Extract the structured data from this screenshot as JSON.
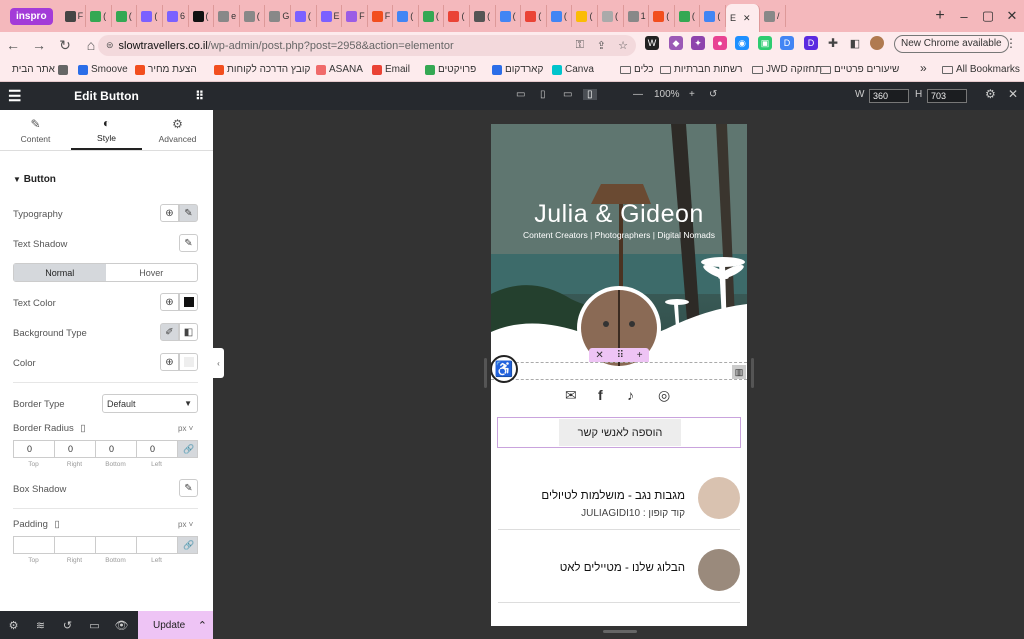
{
  "browser": {
    "profile_label": "inspro",
    "tabs": [
      {
        "label": "F",
        "color": "#444"
      },
      {
        "label": "(",
        "color": "#34a853"
      },
      {
        "label": "(",
        "color": "#34a853"
      },
      {
        "label": "(",
        "color": "#7b61ff"
      },
      {
        "label": "6",
        "color": "#7b61ff"
      },
      {
        "label": "(",
        "color": "#111"
      },
      {
        "label": "e",
        "color": "#888"
      },
      {
        "label": "(",
        "color": "#888"
      },
      {
        "label": "G",
        "color": "#888"
      },
      {
        "label": "(",
        "color": "#7b61ff"
      },
      {
        "label": "E",
        "color": "#7b61ff"
      },
      {
        "label": "F",
        "color": "#9b5de5"
      },
      {
        "label": "F",
        "color": "#f24e1e"
      },
      {
        "label": "(",
        "color": "#4285f4"
      },
      {
        "label": "(",
        "color": "#34a853"
      },
      {
        "label": "(",
        "color": "#ea4335"
      },
      {
        "label": "(",
        "color": "#555"
      },
      {
        "label": "(",
        "color": "#4285f4"
      },
      {
        "label": "(",
        "color": "#ea4335"
      },
      {
        "label": "(",
        "color": "#4285f4"
      },
      {
        "label": "(",
        "color": "#fbbc05"
      },
      {
        "label": "(",
        "color": "#aaa"
      },
      {
        "label": "1",
        "color": "#888"
      },
      {
        "label": "(",
        "color": "#f24e1e"
      },
      {
        "label": "(",
        "color": "#34a853"
      },
      {
        "label": "(",
        "color": "#4285f4"
      }
    ],
    "active_tab": {
      "label": "E",
      "close": "✕"
    },
    "after_tabs": [
      {
        "label": "/",
        "color": "#888"
      }
    ],
    "new_tab": "+",
    "url_host": "slowtravellers.co.il",
    "url_path": "/wp-admin/post.php?post=2958&action=elementor",
    "new_chrome": "New Chrome available",
    "bookmarks": [
      {
        "label": "אתר הבית",
        "icon": "bookmark-icon",
        "color": "#666"
      },
      {
        "label": "Smoove",
        "icon": "smoove-icon",
        "color": "#2b6de8"
      },
      {
        "label": "הצעת מחיר",
        "icon": "figma-icon",
        "color": "#f24e1e"
      },
      {
        "label": "קובץ הדרכה לקוחות",
        "icon": "figma-icon",
        "color": "#f24e1e"
      },
      {
        "label": "ASANA",
        "icon": "asana-icon",
        "color": "#f06a6a"
      },
      {
        "label": "Email",
        "icon": "gmail-icon",
        "color": "#ea4335"
      },
      {
        "label": "פרויקטים",
        "icon": "drive-icon",
        "color": "#34a853"
      },
      {
        "label": "קארדקום",
        "icon": "cardcom-icon",
        "color": "#2b6de8"
      },
      {
        "label": "Canva",
        "icon": "canva-icon",
        "color": "#00c4cc"
      },
      {
        "label": "כלים",
        "icon": "folder-icon",
        "color": "#666"
      },
      {
        "label": "רשתות חברתיות",
        "icon": "folder-icon",
        "color": "#666"
      },
      {
        "label": "JWD תחזוקה",
        "icon": "folder-icon",
        "color": "#666"
      },
      {
        "label": "שיעורים פרטיים",
        "icon": "folder-icon",
        "color": "#666"
      }
    ],
    "more": "»",
    "all_bookmarks": "All Bookmarks"
  },
  "panel": {
    "title": "Edit Button",
    "tabs": [
      "Content",
      "Style",
      "Advanced"
    ],
    "section": "Button",
    "typography": "Typography",
    "text_shadow": "Text Shadow",
    "state_normal": "Normal",
    "state_hover": "Hover",
    "text_color": "Text Color",
    "background_type": "Background Type",
    "color": "Color",
    "border_type": "Border Type",
    "border_type_value": "Default",
    "border_radius": "Border Radius",
    "unit": "px",
    "radius_values": [
      "0",
      "0",
      "0",
      "0"
    ],
    "side_labels": [
      "Top",
      "Right",
      "Bottom",
      "Left"
    ],
    "box_shadow": "Box Shadow",
    "padding": "Padding",
    "padding_values": [
      "",
      "",
      "",
      ""
    ],
    "update": "Update"
  },
  "preview": {
    "zoom": "100%",
    "width_label": "W",
    "width_value": "360",
    "height_label": "H",
    "height_value": "703"
  },
  "page": {
    "title": "Julia & Gideon",
    "subtitle": "Content Creators | Photographers | Digital Nomads",
    "button_text": "הוספה לאנשי קשר",
    "items": [
      {
        "title": "מגבות נגב - מושלמות לטיולים",
        "sub": "קוד קופון : JULIAGIDI10"
      },
      {
        "title": "הבלוג שלנו - מטיילים לאט",
        "sub": ""
      }
    ]
  }
}
